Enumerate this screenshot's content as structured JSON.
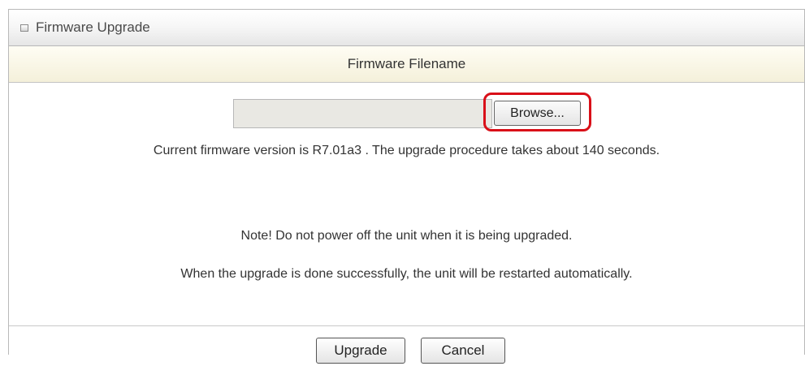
{
  "panel": {
    "title": "Firmware Upgrade",
    "icon": "square-icon"
  },
  "section": {
    "header": "Firmware Filename"
  },
  "file": {
    "value": "",
    "browse_label": "Browse..."
  },
  "messages": {
    "current": "Current firmware version is R7.01a3 . The upgrade procedure takes about 140 seconds.",
    "note": "Note! Do not power off the unit when it is being upgraded.",
    "restart": "When the upgrade is done successfully, the unit will be restarted automatically."
  },
  "actions": {
    "upgrade": "Upgrade",
    "cancel": "Cancel"
  },
  "colors": {
    "highlight": "#d90f18",
    "header_bg": "#f4f0da"
  }
}
